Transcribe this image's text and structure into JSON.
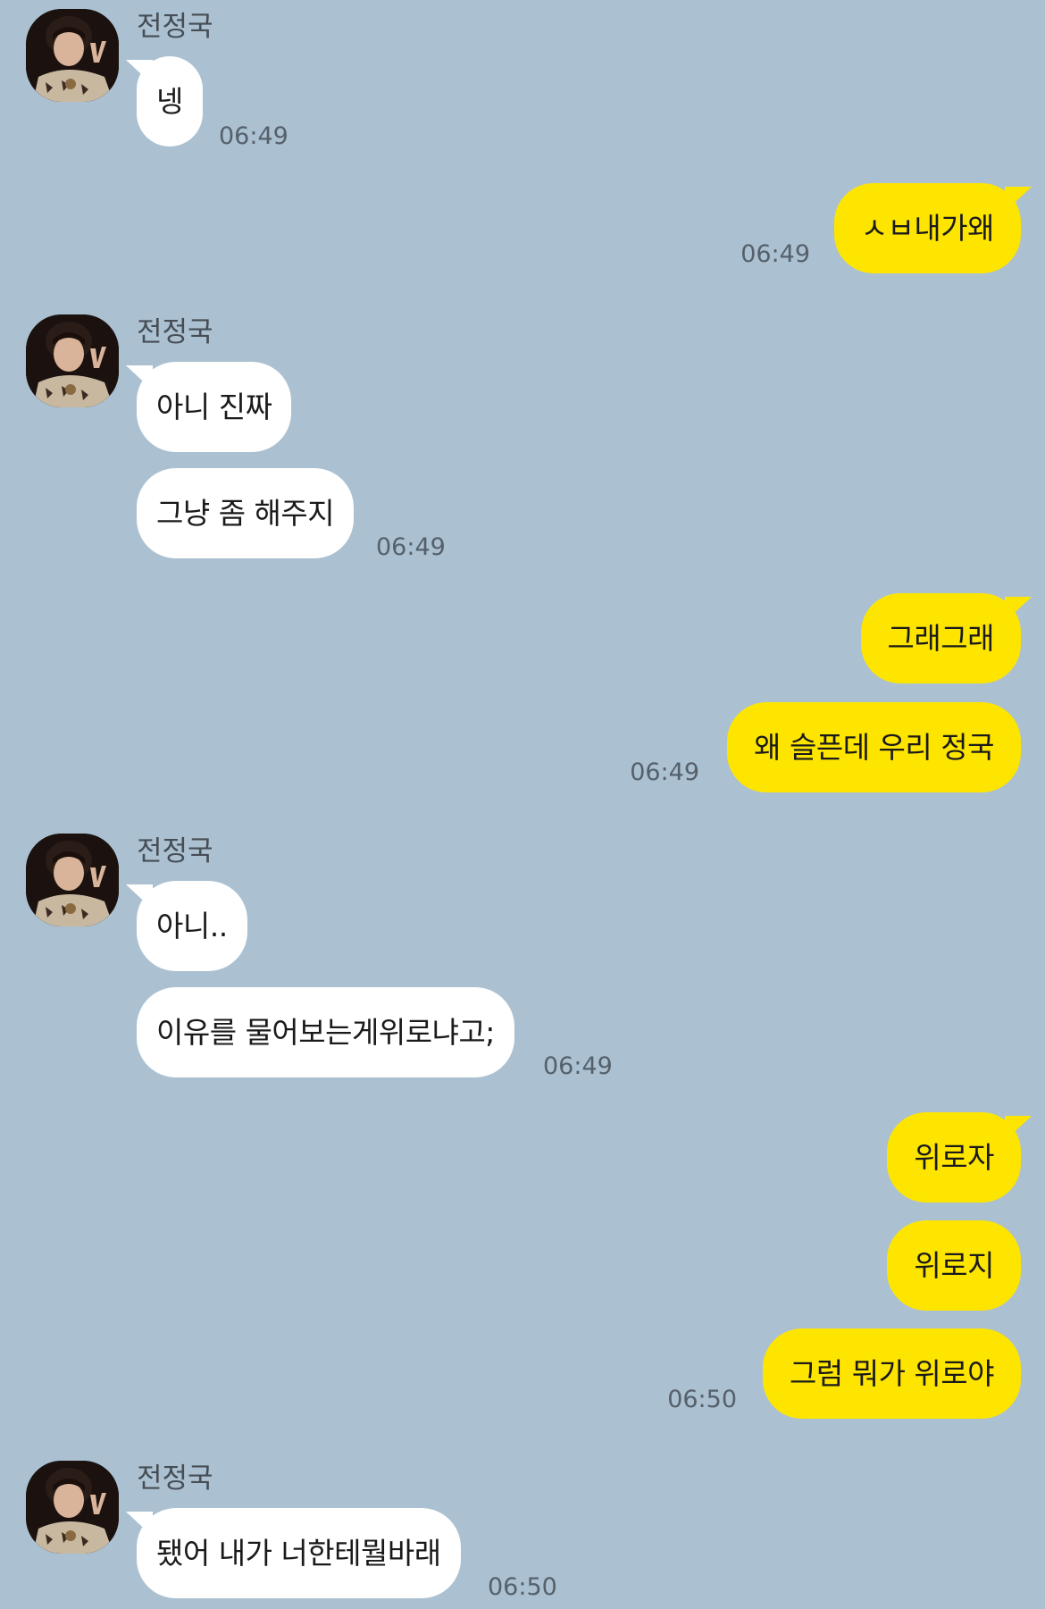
{
  "contact": {
    "name": "전정국"
  },
  "groups": [
    {
      "side": "in",
      "messages": [
        "넹"
      ],
      "time": "06:49"
    },
    {
      "side": "out",
      "messages": [
        "ㅅㅂ내가왜"
      ],
      "time": "06:49"
    },
    {
      "side": "in",
      "messages": [
        "아니 진짜",
        "그냥 좀 해주지"
      ],
      "time": "06:49"
    },
    {
      "side": "out",
      "messages": [
        "그래그래",
        "왜 슬픈데 우리 정국"
      ],
      "time": "06:49"
    },
    {
      "side": "in",
      "messages": [
        "아니..",
        "이유를 물어보는게위로냐고;"
      ],
      "time": "06:49"
    },
    {
      "side": "out",
      "messages": [
        "위로자",
        "위로지",
        "그럼 뭐가 위로야"
      ],
      "time": "06:50"
    },
    {
      "side": "in",
      "messages": [
        "됐어 내가 너한테뭘바래"
      ],
      "time": "06:50"
    }
  ],
  "colors": {
    "background": "#abc1d1",
    "outgoing_bubble": "#fee500",
    "incoming_bubble": "#ffffff"
  }
}
